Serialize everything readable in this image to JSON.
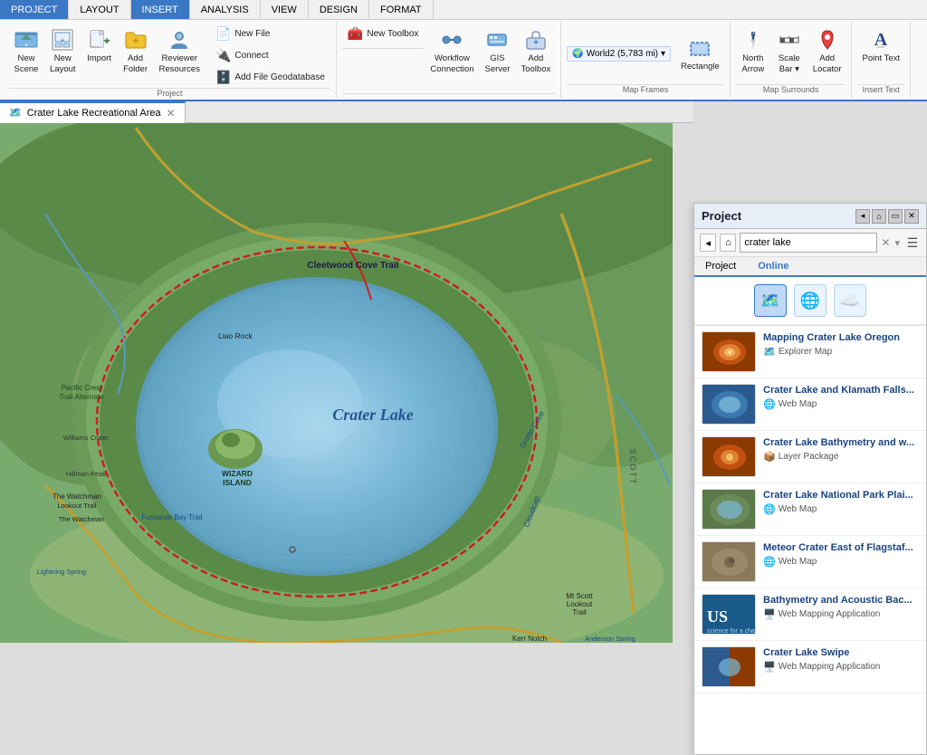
{
  "ribbon": {
    "tabs": [
      {
        "label": "PROJECT",
        "active": false
      },
      {
        "label": "LAYOUT",
        "active": false
      },
      {
        "label": "INSERT",
        "active": true
      },
      {
        "label": "ANALYSIS",
        "active": false
      },
      {
        "label": "VIEW",
        "active": false
      },
      {
        "label": "DESIGN",
        "active": false
      },
      {
        "label": "FORMAT",
        "active": false
      }
    ],
    "groups": [
      {
        "name": "project-group",
        "label": "Project",
        "items": [
          {
            "id": "new-scene",
            "label": "New\nScene",
            "icon": "🗺️",
            "type": "big"
          },
          {
            "id": "new-layout",
            "label": "New\nLayout",
            "icon": "📄",
            "type": "big"
          },
          {
            "id": "import",
            "label": "Import",
            "icon": "📥",
            "type": "big"
          },
          {
            "id": "add-folder",
            "label": "Add\nFolder",
            "icon": "📁",
            "type": "big"
          },
          {
            "id": "reviewer-resources",
            "label": "Reviewer\nResources",
            "icon": "👁️",
            "type": "big"
          }
        ],
        "small_items": [
          {
            "id": "new-file",
            "label": "New File",
            "icon": "📄"
          },
          {
            "id": "connect",
            "label": "Connect",
            "icon": "🔌"
          },
          {
            "id": "add-file-geodatabase",
            "label": "Add File Geodatabase",
            "icon": "🗄️"
          }
        ]
      },
      {
        "name": "workflow-group",
        "label": "",
        "items": [
          {
            "id": "workflow-connection",
            "label": "Workflow\nConnection",
            "icon": "⚙️",
            "type": "big"
          },
          {
            "id": "gis-server",
            "label": "GIS\nServer",
            "icon": "🖥️",
            "type": "big"
          },
          {
            "id": "add-toolbox",
            "label": "Add\nToolbox",
            "icon": "🧰",
            "type": "big"
          }
        ],
        "small_items": [
          {
            "id": "new-toolbox",
            "label": "New Toolbox",
            "icon": "🧰"
          }
        ]
      },
      {
        "name": "map-frames-group",
        "label": "Map Frames",
        "items": [
          {
            "id": "rectangle",
            "label": "Rectangle",
            "icon": "⬜",
            "type": "big"
          }
        ],
        "extra": "World2 (5,783 mi)"
      },
      {
        "name": "map-surrounds-group",
        "label": "Map Surrounds",
        "items": [
          {
            "id": "north-arrow",
            "label": "North\nArrow",
            "icon": "🧭",
            "type": "big"
          },
          {
            "id": "scale-bar",
            "label": "Scale\nBar",
            "icon": "📏",
            "type": "big"
          },
          {
            "id": "add-locator",
            "label": "Add\nLocator",
            "icon": "📍",
            "type": "big"
          }
        ]
      },
      {
        "name": "insert-text-group",
        "label": "Insert Text",
        "items": [
          {
            "id": "point-text",
            "label": "Point Text",
            "icon": "A",
            "type": "big"
          }
        ]
      }
    ]
  },
  "map": {
    "tab_title": "Crater Lake Recreational Area",
    "content": "crater_lake_map"
  },
  "project_panel": {
    "title": "Project",
    "search_value": "crater lake",
    "tabs": [
      "Project",
      "Online"
    ],
    "active_tab": "Online",
    "categories": [
      {
        "id": "maps-cat",
        "icon": "🗺️",
        "active": true
      },
      {
        "id": "layers-cat",
        "icon": "🌐",
        "active": false
      },
      {
        "id": "cloud-cat",
        "icon": "☁️",
        "active": false
      }
    ],
    "results": [
      {
        "id": "result-1",
        "title": "Mapping Crater Lake Oregon",
        "type": "Explorer Map",
        "type_icon": "🗺️",
        "thumb_color": "#8B3A00"
      },
      {
        "id": "result-2",
        "title": "Crater Lake and Klamath Falls...",
        "type": "Web Map",
        "type_icon": "🌐",
        "thumb_color": "#2d5a8e"
      },
      {
        "id": "result-3",
        "title": "Crater Lake Bathymetry and w...",
        "type": "Layer Package",
        "type_icon": "📦",
        "thumb_color": "#8B3A00"
      },
      {
        "id": "result-4",
        "title": "Crater Lake National Park Plai...",
        "type": "Web Map",
        "type_icon": "🌐",
        "thumb_color": "#5a7a4a"
      },
      {
        "id": "result-5",
        "title": "Meteor Crater East of Flagstaf...",
        "type": "Web Map",
        "type_icon": "🌐",
        "thumb_color": "#8a7a5a"
      },
      {
        "id": "result-6",
        "title": "Bathymetry and Acoustic Bac...",
        "type": "Web Mapping Application",
        "type_icon": "🖥️",
        "thumb_color": "#1a5a8a",
        "logo": "US"
      },
      {
        "id": "result-7",
        "title": "Crater Lake Swipe",
        "type": "Web Mapping Application",
        "type_icon": "🖥️",
        "thumb_color": "#2d5a8e"
      }
    ]
  },
  "status_bar": {
    "text": ""
  }
}
